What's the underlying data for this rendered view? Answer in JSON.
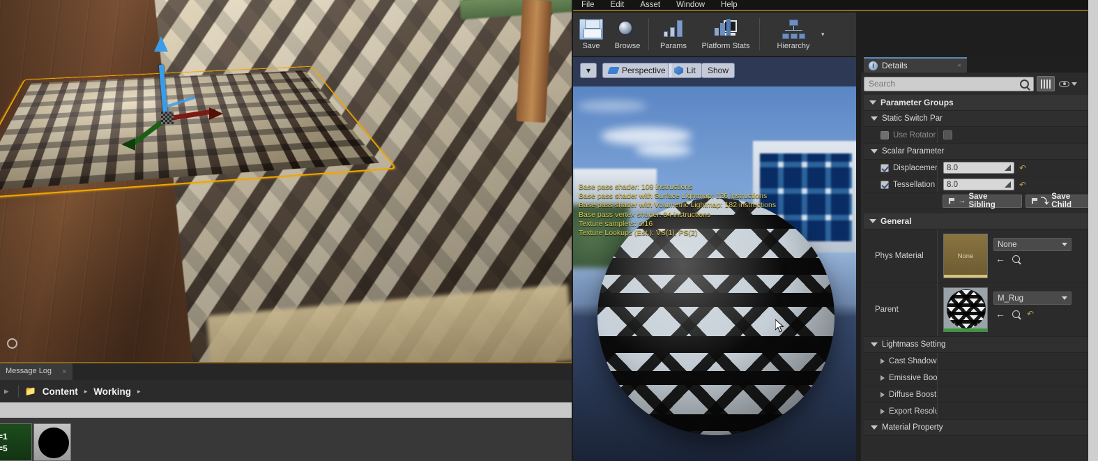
{
  "app": {
    "menubar": [
      "File",
      "Edit",
      "Asset",
      "Window",
      "Help"
    ],
    "accent_color": "#8c6a1e"
  },
  "toolbar": {
    "buttons": [
      {
        "label": "Save",
        "icon": "floppy-disk-icon"
      },
      {
        "label": "Browse",
        "icon": "magnifier-icon"
      },
      {
        "label": "Params",
        "icon": "bar-chart-icon"
      },
      {
        "label": "Platform Stats",
        "icon": "monitor-stats-icon"
      },
      {
        "label": "Hierarchy",
        "icon": "hierarchy-tree-icon"
      }
    ]
  },
  "viewport_toolbar": {
    "menu_caret": "▾",
    "perspective": "Perspective",
    "lit": "Lit",
    "show": "Show"
  },
  "viewport_stats": [
    "Base pass shader: 109 instructions",
    "Base pass shader with Surface Lightmap: 126 instructions",
    "Base pass shader with Volumetric Lightmap: 182 instructions",
    "Base pass vertex shader: 84 instructions",
    "Texture samplers: 5/16",
    "Texture Lookups (Est.): VS(1), PS(2)"
  ],
  "details": {
    "tab_label": "Details",
    "tab_close": "×",
    "search_placeholder": "Search",
    "search_value": "",
    "grid_view_icon": "grid-view-icon",
    "eye_icon": "eye-icon",
    "groups": {
      "parameter_groups": "Parameter Groups",
      "static_switch": "Static Switch Par",
      "scalar_parameters": "Scalar Parameter",
      "general": "General",
      "lightmass": "Lightmass Setting",
      "material_property": "Material Property"
    },
    "static_switch_rows": [
      {
        "label": "Use Rotator",
        "checked": false,
        "enabled": false
      }
    ],
    "scalar_rows": [
      {
        "label": "Displacement",
        "checked": true,
        "value": "8.0"
      },
      {
        "label": "Tessellation",
        "checked": true,
        "value": "8.0"
      }
    ],
    "save_buttons": [
      {
        "label": "Save Sibling",
        "glyph": "→"
      },
      {
        "label": "Save Child",
        "glyph": "⤵"
      }
    ],
    "general_rows": [
      {
        "label": "Phys Material",
        "thumb_caption": "None",
        "value": "None",
        "has_reset": false
      },
      {
        "label": "Parent",
        "thumb_caption": "",
        "value": "M_Rug",
        "has_reset": true
      }
    ],
    "lightmass_rows": [
      "Cast Shadow as",
      "Emissive Boost",
      "Diffuse Boost",
      "Export Resolutio"
    ]
  },
  "message_log": {
    "tab_label": "Message Log",
    "tab_close": "×"
  },
  "content_browser": {
    "back_arrow": "▸",
    "folder_icon": "folder-icon",
    "path": [
      "Content",
      "Working"
    ],
    "separator": "▸",
    "thumbnails": [
      {
        "name": "asset-thumbnail-green",
        "line1": "=1",
        "line2": "=5"
      },
      {
        "name": "asset-thumbnail-sphere",
        "line1": "",
        "line2": ""
      }
    ]
  }
}
